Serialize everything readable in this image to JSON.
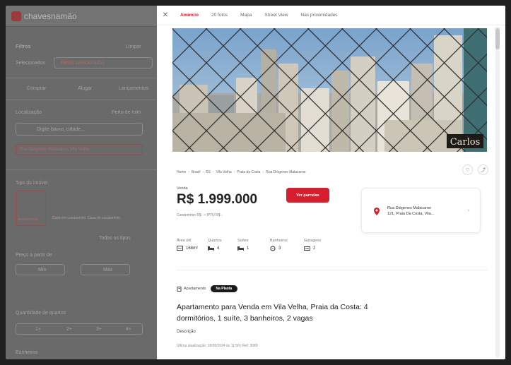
{
  "background": {
    "logo_text": "chavesnamão",
    "filters_label": "Filtros",
    "clear_label": "Limpar",
    "selected_label": "Selecionados",
    "active_filters": "Filtros selecionados",
    "tabs": [
      "Comprar",
      "Alugar",
      "Lançamentos"
    ],
    "location_label": "Localização",
    "near_label": "Perto de mim",
    "location_placeholder": "Digite bairro, cidade...",
    "location_chip": "Rua Diógenes Malacarne, Vila Velha",
    "property_type_label": "Tipo do imóvel",
    "property_types": [
      "Apartamento",
      "Casa em condomínio",
      "Casa de condomínio"
    ],
    "see_all_types": "Todos os tipos",
    "price_label": "Preço à partir de",
    "price_min": "Mín",
    "price_max": "Máx",
    "rooms_label": "Quantidade de quartos",
    "room_options": [
      "1+",
      "2+",
      "3+",
      "4+"
    ],
    "bathrooms_label": "Banheiros"
  },
  "modal": {
    "close_icon": "close-icon",
    "tabs": [
      "Anúncio",
      "20 fotos",
      "Mapa",
      "Street View",
      "Nas proximidades"
    ],
    "active_tab": "Anúncio",
    "watermark": "Carlos",
    "breadcrumb": [
      "Home",
      "Brasil",
      "ES",
      "Vila Velha",
      "Praia da Costa",
      "Rua Diógenes Malacarne"
    ],
    "price_label": "Venda",
    "price": "R$ 1.999.000",
    "price_sub": "Condomínio R$ -  •  IPTU R$ -",
    "see_price_button": "Ver parcelas",
    "address_line1": "Rua Diógenes Malacarne",
    "address_line2": "121, Praia Da Costa, Vila...",
    "features": [
      {
        "label": "Área útil",
        "value": "168m²",
        "icon": "area-icon"
      },
      {
        "label": "Quartos",
        "value": "4",
        "icon": "bed-icon"
      },
      {
        "label": "Suítes",
        "value": "1",
        "icon": "suite-icon"
      },
      {
        "label": "Banheiros",
        "value": "3",
        "icon": "bath-icon"
      },
      {
        "label": "Garagens",
        "value": "2",
        "icon": "garage-icon"
      }
    ],
    "property_type": "Apartamento",
    "badge": "Na Planta",
    "title": "Apartamento para Venda em Vila Velha, Praia da Costa: 4 dormitórios, 1 suíte, 3 banheiros, 2 vagas",
    "description_label": "Descrição",
    "updated": "Última atualização: 18/05/2024 às 11:58 | Ref: 3080",
    "colors": {
      "accent": "#d51f2e",
      "badge": "#1a1a1a"
    }
  }
}
